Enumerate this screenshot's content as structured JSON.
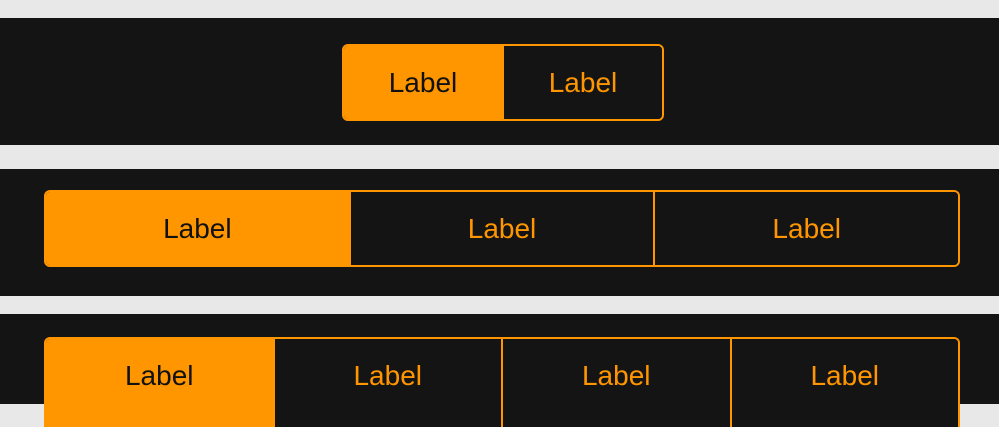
{
  "colors": {
    "accent": "#ff9600",
    "panel_background": "#141414",
    "page_background": "#e8e8e8",
    "selected_text": "#111111"
  },
  "controls": [
    {
      "segments": [
        {
          "label": "Label",
          "selected": true
        },
        {
          "label": "Label",
          "selected": false
        }
      ]
    },
    {
      "segments": [
        {
          "label": "Label",
          "selected": true
        },
        {
          "label": "Label",
          "selected": false
        },
        {
          "label": "Label",
          "selected": false
        }
      ]
    },
    {
      "segments": [
        {
          "label": "Label",
          "selected": true
        },
        {
          "label": "Label",
          "selected": false
        },
        {
          "label": "Label",
          "selected": false
        },
        {
          "label": "Label",
          "selected": false
        }
      ]
    }
  ]
}
